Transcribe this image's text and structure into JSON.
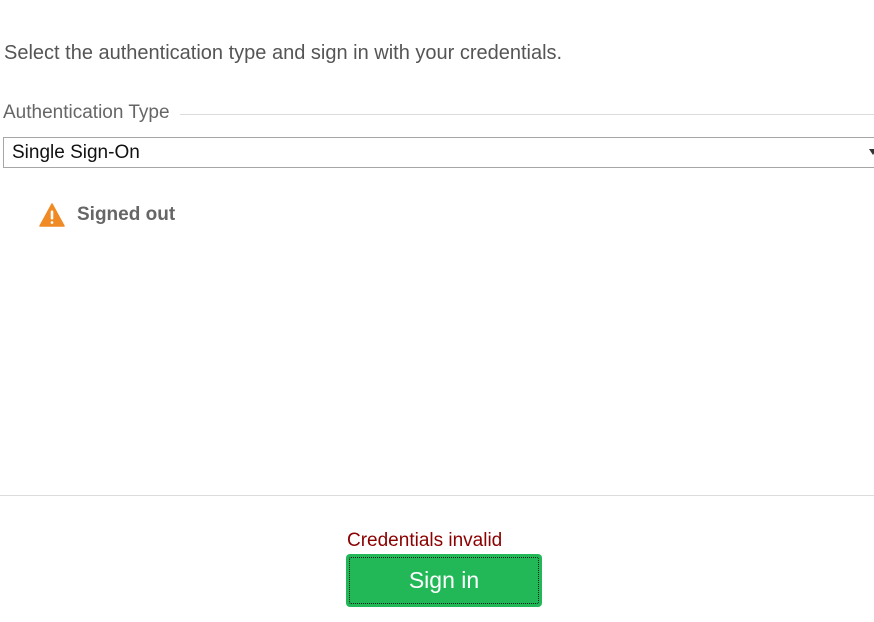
{
  "instruction_text": "Select the authentication type and sign in with your credentials.",
  "auth": {
    "legend": "Authentication Type",
    "selected": "Single Sign-On"
  },
  "status": {
    "icon": "warning-icon",
    "text": "Signed out",
    "icon_color": "#f08a24"
  },
  "footer": {
    "error_text": "Credentials invalid",
    "error_color": "#8b0000",
    "signin_label": "Sign in",
    "signin_color": "#22b858"
  }
}
